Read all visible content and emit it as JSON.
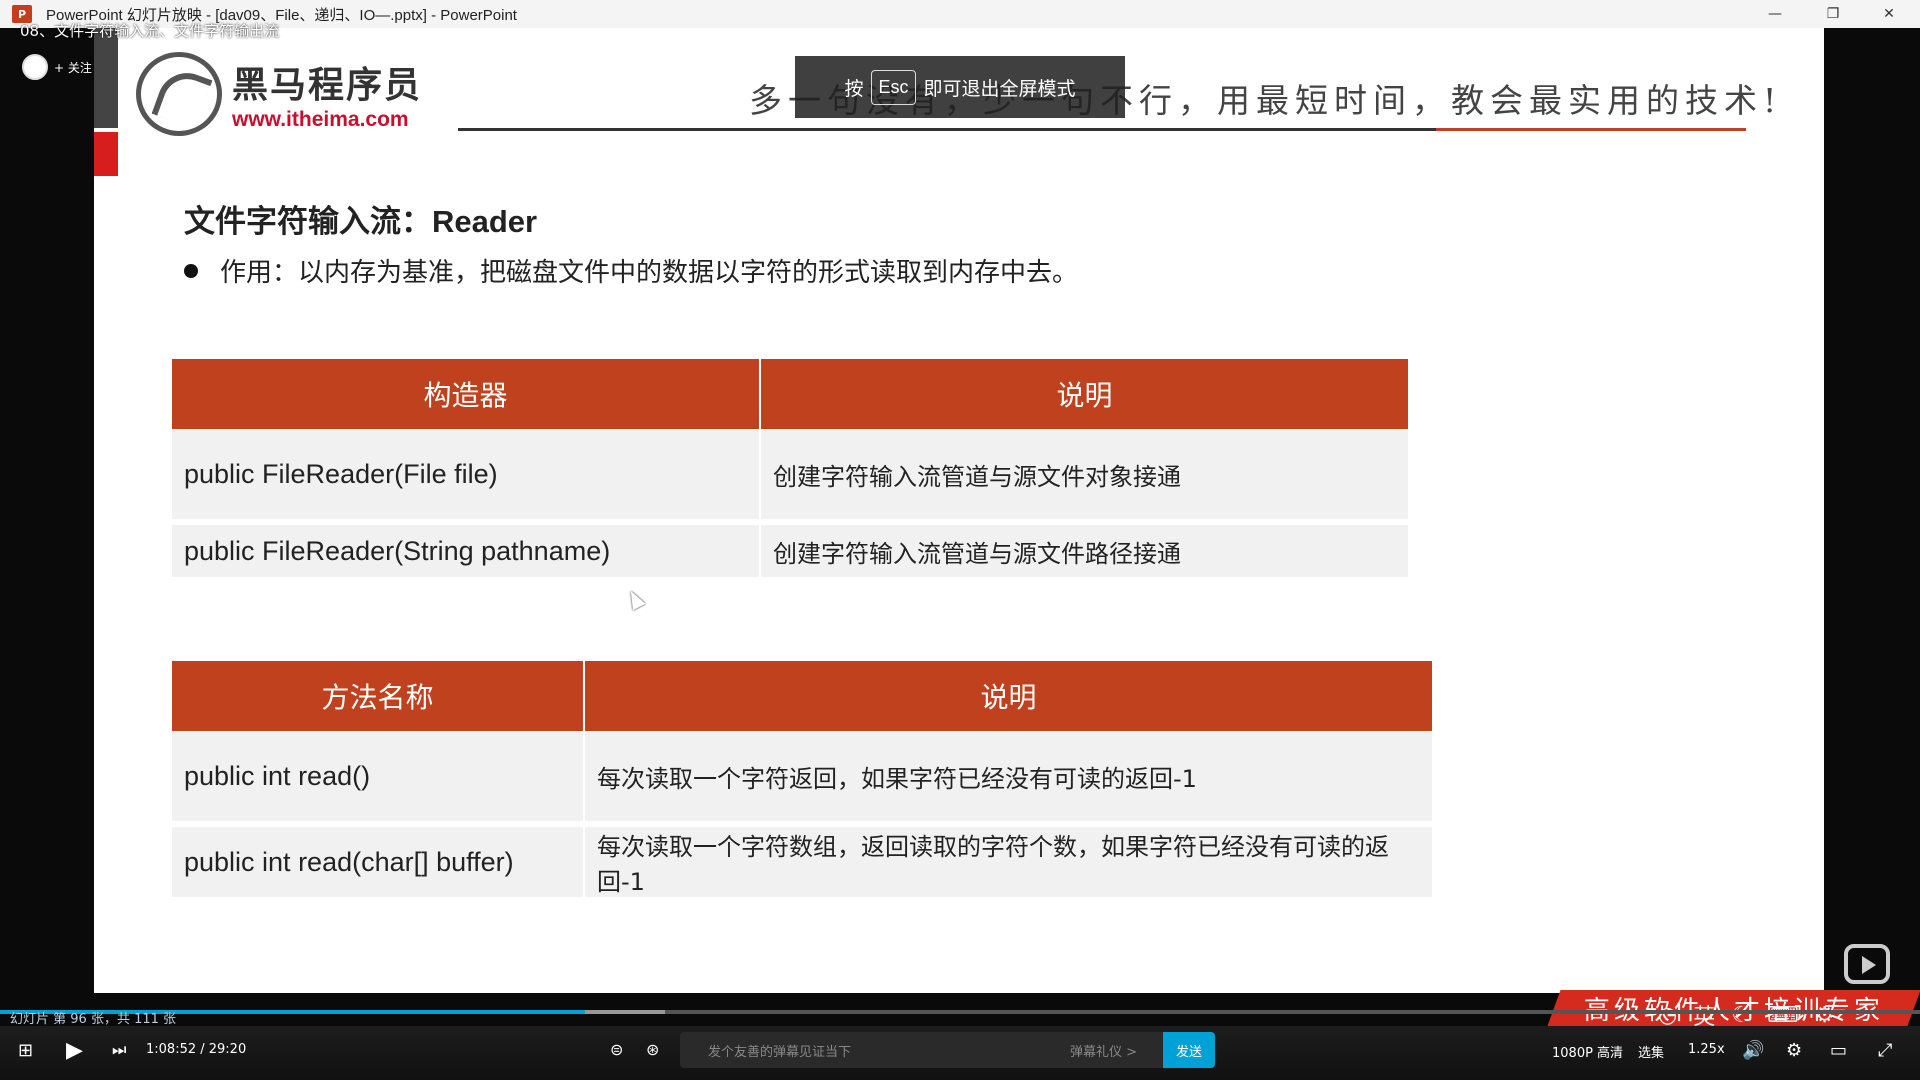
{
  "window": {
    "title": "PowerPoint 幻灯片放映 - [dav09、File、递归、IO—.pptx] - PowerPoint",
    "app_icon": "P",
    "minimize": "—",
    "restore": "❐",
    "close": "✕"
  },
  "video": {
    "title": "08、文件字符输入流、文件字符输出流",
    "follow": "+ 关注"
  },
  "slide": {
    "brand_cn": "黑马程序员",
    "brand_url": "www.itheima.com",
    "slogan": "多一句没有，少一句不行，用最短时间，教会最实用的技术!",
    "esc_tip": {
      "prefix": "按",
      "key": "Esc",
      "suffix": "即可退出全屏模式"
    },
    "heading_cn": "文件字符输入流：",
    "heading_en": "Reader",
    "bullet": "作用：以内存为基准，把磁盘文件中的数据以字符的形式读取到内存中去。",
    "table1": {
      "headers": [
        "构造器",
        "说明"
      ],
      "rows": [
        [
          "public FileReader(File file)",
          "创建字符输入流管道与源文件对象接通"
        ],
        [
          "public FileReader(String pathname)",
          "创建字符输入流管道与源文件路径接通"
        ]
      ]
    },
    "table2": {
      "headers": [
        "方法名称",
        "说明"
      ],
      "rows": [
        [
          "public int read()",
          "每次读取一个字符返回，如果字符已经没有可读的返回-1"
        ],
        [
          "public int read(char[] buffer)",
          "每次读取一个字符数组，返回读取的字符个数，如果字符已经没有可读的返回-1"
        ]
      ]
    },
    "footer_slogan": "高级软件人才培训专家"
  },
  "player": {
    "slide_counter": "幻灯片 第 96 张，共 111 张",
    "time": "1:08:52 / 29:20",
    "danmaku_placeholder": "发个友善的弹幕见证当下",
    "etiquette": "弹幕礼仪 >",
    "send": "发送",
    "quality": "1080P 高清",
    "episodes": "选集",
    "speed": "1.25x",
    "progress_fraction": 0.305
  },
  "ime": {
    "lang": "英"
  }
}
